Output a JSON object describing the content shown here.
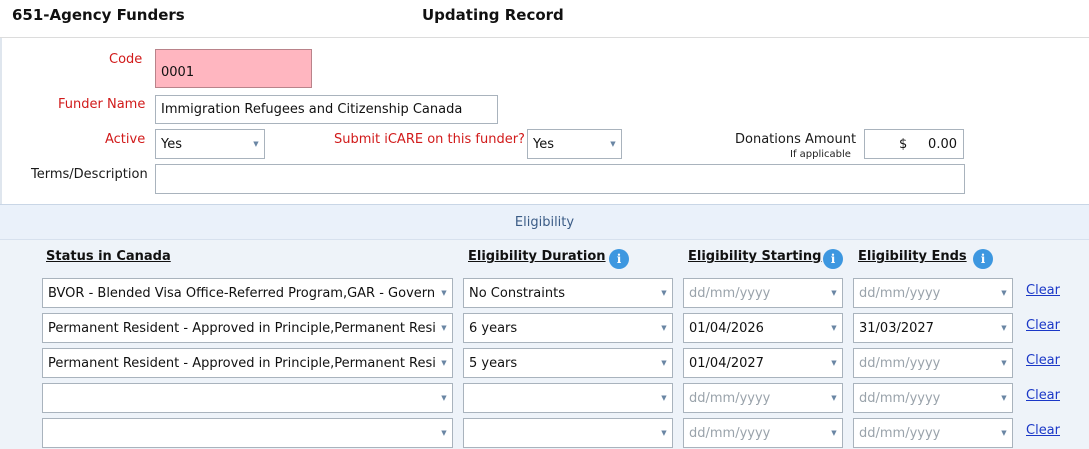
{
  "header": {
    "screen_title": "651-Agency Funders",
    "status": "Updating Record"
  },
  "form": {
    "code": {
      "label": "Code",
      "value": "0001"
    },
    "funder_name": {
      "label": "Funder Name",
      "value": "Immigration Refugees and Citizenship Canada"
    },
    "active": {
      "label": "Active",
      "value": "Yes"
    },
    "submit_icare": {
      "label": "Submit iCARE on this funder?",
      "value": "Yes"
    },
    "donations": {
      "label": "Donations Amount",
      "sublabel": "If applicable",
      "currency": "$",
      "value": "0.00"
    },
    "terms": {
      "label": "Terms/Description",
      "value": ""
    }
  },
  "eligibility": {
    "section_title": "Eligibility",
    "columns": {
      "status": "Status in Canada",
      "duration": "Eligibility Duration",
      "starting": "Eligibility Starting",
      "ends": "Eligibility Ends"
    },
    "info_glyph": "i",
    "date_placeholder": "dd/mm/yyyy",
    "clear_label": "Clear",
    "rows": [
      {
        "status": "BVOR - Blended Visa Office-Referred Program,GAR - Govern",
        "duration": "No Constraints",
        "starting": "",
        "ends": ""
      },
      {
        "status": "Permanent Resident - Approved in Principle,Permanent Resi",
        "duration": "6 years",
        "starting": "01/04/2026",
        "ends": "31/03/2027"
      },
      {
        "status": "Permanent Resident - Approved in Principle,Permanent Resi",
        "duration": "5 years",
        "starting": "01/04/2027",
        "ends": ""
      },
      {
        "status": "",
        "duration": "",
        "starting": "",
        "ends": ""
      },
      {
        "status": "",
        "duration": "",
        "starting": "",
        "ends": ""
      }
    ]
  },
  "icons": {
    "dropdown": "chevron-down-icon",
    "info": "info-icon"
  },
  "colors": {
    "required_label": "#d11a1a",
    "code_bg": "#ffb6c0",
    "section_bg": "#eaf1fa",
    "info_icon": "#3d97e0",
    "link": "#1a37c7"
  }
}
